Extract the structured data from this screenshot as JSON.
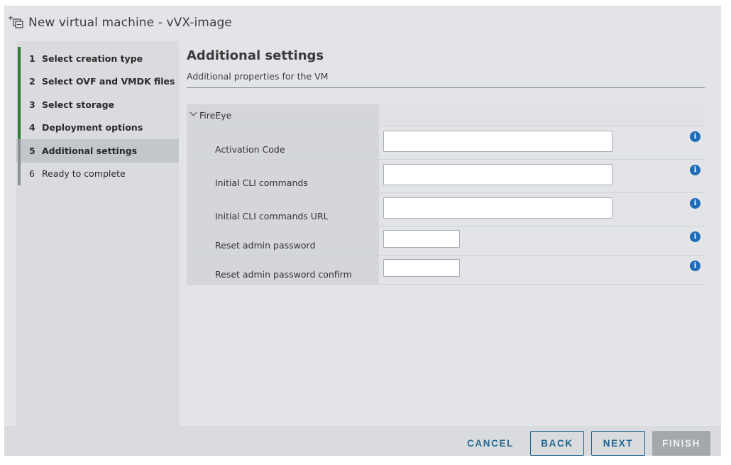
{
  "window": {
    "title": "New virtual machine - vVX-image",
    "icon": "new-vm-icon"
  },
  "wizard": {
    "steps": [
      {
        "num": "1",
        "label": "Select creation type",
        "state": "done"
      },
      {
        "num": "2",
        "label": "Select OVF and VMDK files",
        "state": "done"
      },
      {
        "num": "3",
        "label": "Select storage",
        "state": "done"
      },
      {
        "num": "4",
        "label": "Deployment options",
        "state": "done"
      },
      {
        "num": "5",
        "label": "Additional settings",
        "state": "active"
      },
      {
        "num": "6",
        "label": "Ready to complete",
        "state": "pending"
      }
    ]
  },
  "main": {
    "title": "Additional settings",
    "subtitle": "Additional properties for the VM",
    "group": {
      "label": "FireEye",
      "expanded": true,
      "properties": [
        {
          "label": "Activation Code",
          "value": "",
          "type": "text"
        },
        {
          "label": "Initial CLI commands",
          "value": "",
          "type": "text"
        },
        {
          "label": "Initial CLI commands URL",
          "value": "",
          "type": "text"
        },
        {
          "label": "Reset admin password",
          "value": "",
          "type": "password"
        },
        {
          "label": "Reset admin password confirm",
          "value": "",
          "type": "password"
        }
      ]
    }
  },
  "footer": {
    "cancel": "CANCEL",
    "back": "BACK",
    "next": "NEXT",
    "finish": "FINISH",
    "finish_enabled": false
  },
  "colors": {
    "step_done": "#2e7d32",
    "step_pending": "#8c8f93",
    "primary": "#1d6590",
    "info": "#1e6bb8",
    "disabled": "#a4a8ad"
  }
}
